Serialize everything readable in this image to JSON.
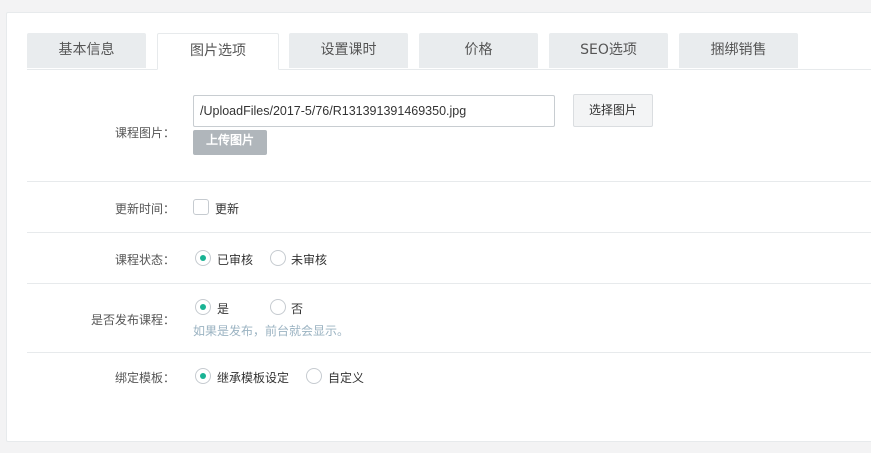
{
  "tabs": [
    {
      "label": "基本信息"
    },
    {
      "label": "图片选项"
    },
    {
      "label": "设置课时"
    },
    {
      "label": "价格"
    },
    {
      "label": "SEO选项"
    },
    {
      "label": "捆绑销售"
    }
  ],
  "active_tab": "图片选项",
  "image": {
    "label": "课程图片：",
    "value": "/UploadFiles/2017-5/76/R131391391469350.jpg",
    "select_button": "选择图片",
    "upload_button": "上传图片"
  },
  "update_time": {
    "label": "更新时间：",
    "checkbox_label": "更新",
    "checked": false
  },
  "status": {
    "label": "课程状态：",
    "options": [
      "已审核",
      "未审核"
    ],
    "selected": "已审核"
  },
  "publish": {
    "label": "是否发布课程：",
    "options": [
      "是",
      "否"
    ],
    "selected": "是",
    "hint": "如果是发布，前台就会显示。"
  },
  "template": {
    "label": "绑定模板：",
    "options": [
      "继承模板设定",
      "自定义"
    ],
    "selected": "继承模板设定"
  },
  "colors": {
    "accent": "#1ab394",
    "hint": "#9bb3c2"
  }
}
